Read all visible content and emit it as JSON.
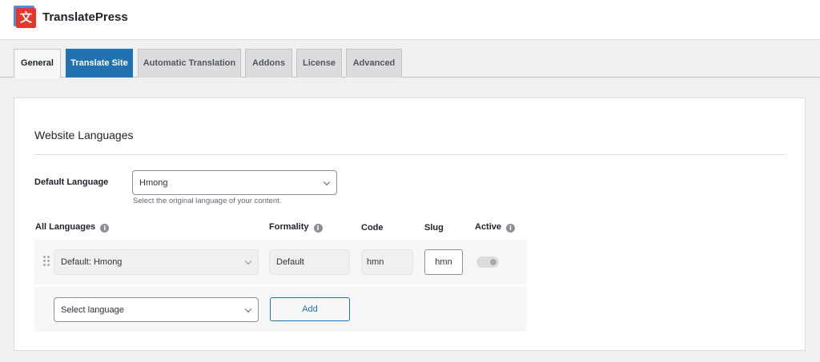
{
  "header": {
    "logo_glyph": "文",
    "brand": "TranslatePress",
    "logo_icon": "translatepress-logo-icon"
  },
  "tabs": [
    {
      "label": "General",
      "state": "active"
    },
    {
      "label": "Translate Site",
      "state": "highlight"
    },
    {
      "label": "Automatic Translation",
      "state": "inactive"
    },
    {
      "label": "Addons",
      "state": "inactive"
    },
    {
      "label": "License",
      "state": "inactive"
    },
    {
      "label": "Advanced",
      "state": "inactive"
    }
  ],
  "section": {
    "title": "Website Languages"
  },
  "default_language": {
    "label": "Default Language",
    "value": "Hmong",
    "hint": "Select the original language of your content."
  },
  "table": {
    "headers": {
      "languages": "All Languages",
      "formality": "Formality",
      "code": "Code",
      "slug": "Slug",
      "active": "Active"
    },
    "info_glyph": "i",
    "row": {
      "language": "Default: Hmong",
      "formality": "Default",
      "code": "hmn",
      "slug": "hmn",
      "active": true
    },
    "new_row": {
      "select_placeholder": "Select language",
      "add_label": "Add"
    }
  },
  "colors": {
    "accent": "#2271b1",
    "logo_red": "#e0392b",
    "logo_blue": "#4a90d9"
  }
}
